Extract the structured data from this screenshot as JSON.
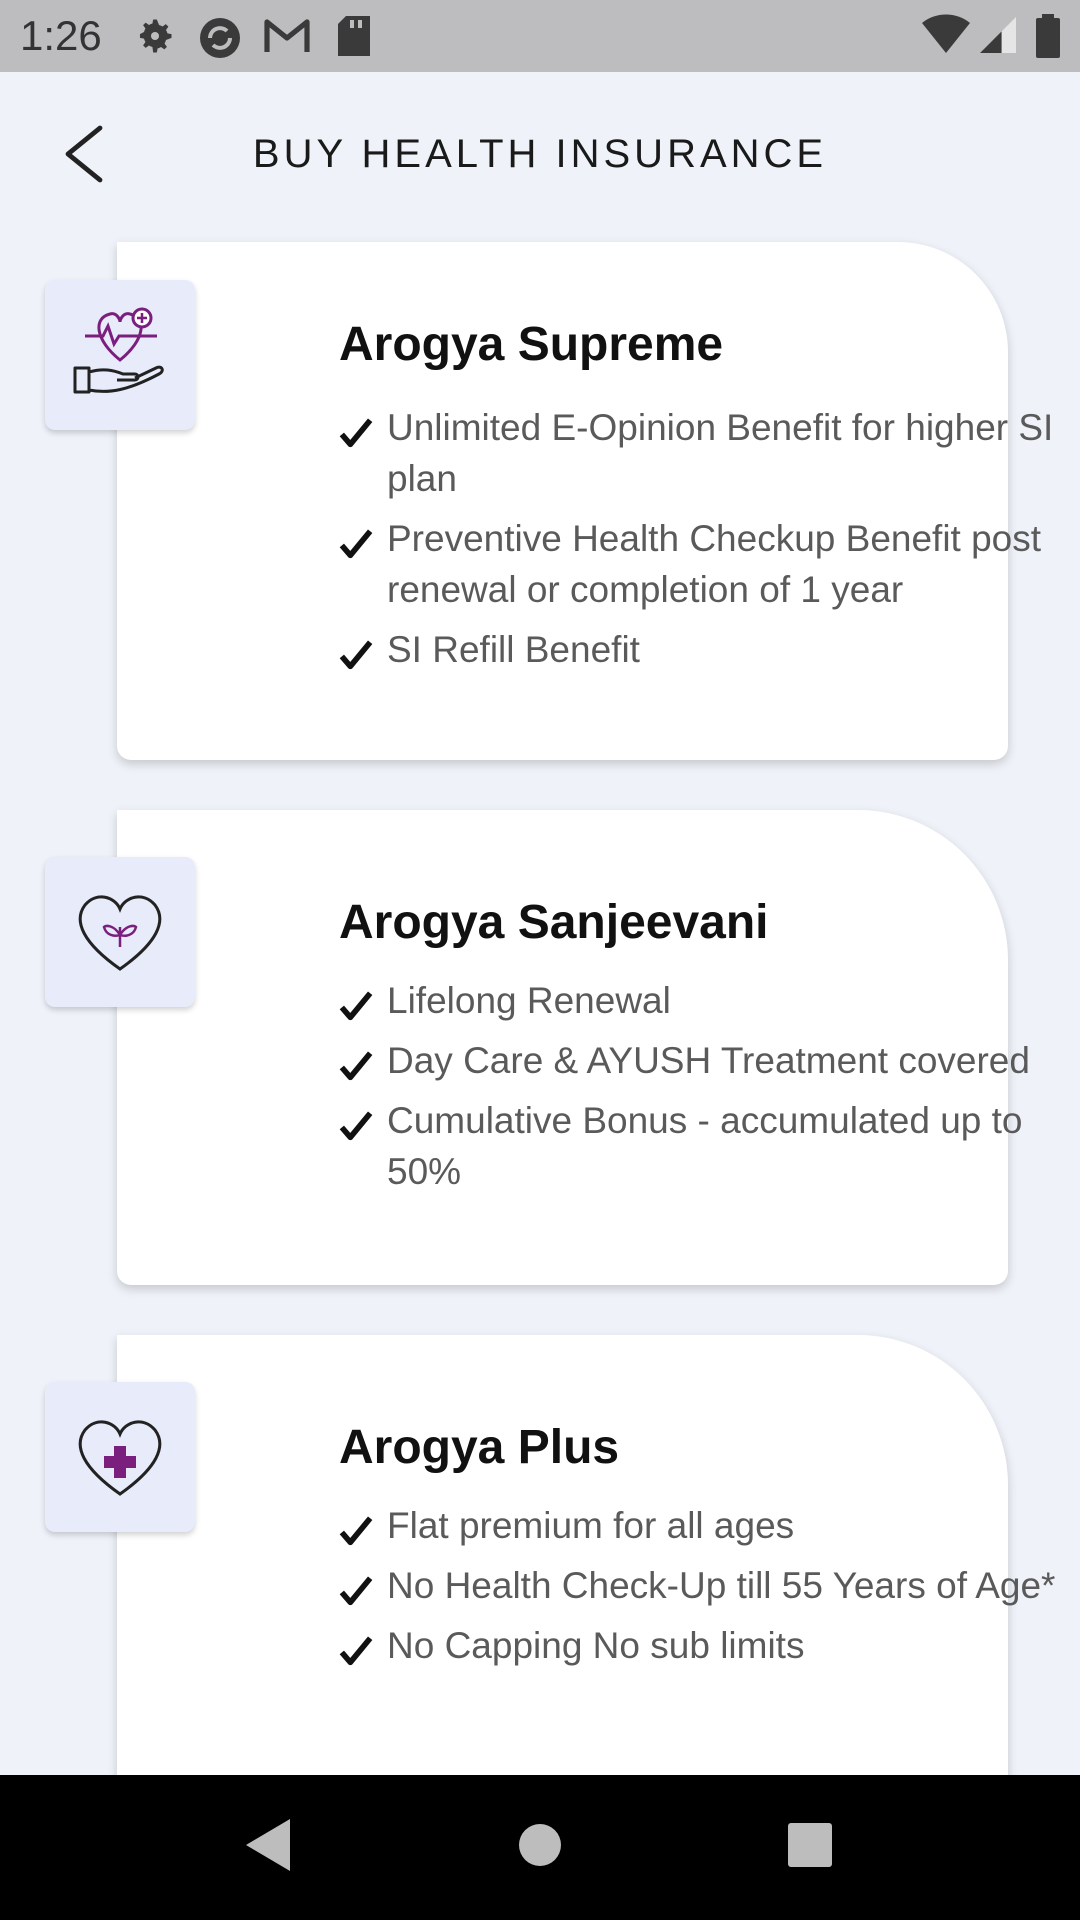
{
  "status_bar": {
    "time": "1:26",
    "left_icons": [
      "gear-icon",
      "sync-icon",
      "gmail-icon",
      "sd-card-icon"
    ],
    "right_icons": [
      "wifi-icon",
      "signal-icon",
      "battery-icon"
    ]
  },
  "header": {
    "title": "BUY HEALTH INSURANCE",
    "back_icon": "chevron-left-icon"
  },
  "accent_color": "#7b1f7e",
  "plans": [
    {
      "name": "Arogya Supreme",
      "icon": "heart-hand-icon",
      "features": [
        "Unlimited E-Opinion Benefit for higher SI plan",
        "Preventive Health Checkup Benefit post renewal or completion of 1 year",
        "SI Refill Benefit"
      ]
    },
    {
      "name": "Arogya Sanjeevani",
      "icon": "heart-leaf-icon",
      "features": [
        "Lifelong Renewal",
        "Day Care & AYUSH Treatment covered",
        "Cumulative Bonus - accumulated up to 50%"
      ]
    },
    {
      "name": "Arogya Plus",
      "icon": "heart-cross-icon",
      "features": [
        "Flat premium for all ages",
        "No Health Check-Up till 55 Years of Age*",
        "No Capping No sub limits"
      ]
    }
  ],
  "nav_bar": [
    "back-nav-icon",
    "home-nav-icon",
    "recents-nav-icon"
  ]
}
